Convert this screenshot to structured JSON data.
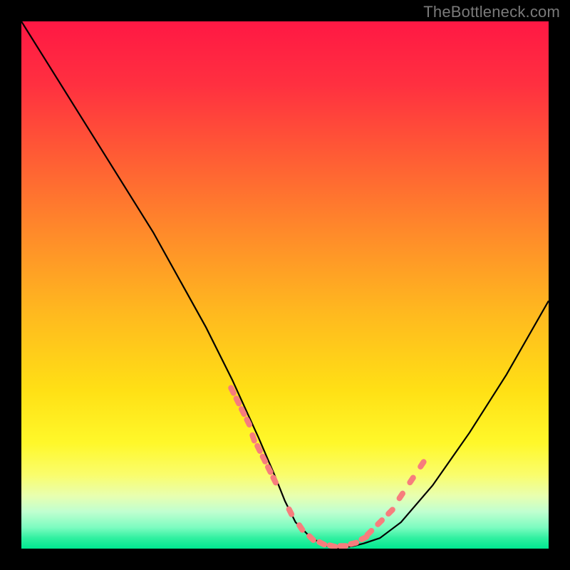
{
  "watermark": "TheBottleneck.com",
  "gradient_stops": [
    {
      "offset": "0%",
      "color": "#ff1844"
    },
    {
      "offset": "12%",
      "color": "#ff3040"
    },
    {
      "offset": "25%",
      "color": "#ff5a35"
    },
    {
      "offset": "40%",
      "color": "#ff8a2a"
    },
    {
      "offset": "55%",
      "color": "#ffb81f"
    },
    {
      "offset": "70%",
      "color": "#ffe015"
    },
    {
      "offset": "80%",
      "color": "#fff82a"
    },
    {
      "offset": "86%",
      "color": "#fafd6c"
    },
    {
      "offset": "90%",
      "color": "#e8ffb0"
    },
    {
      "offset": "93%",
      "color": "#c0ffd0"
    },
    {
      "offset": "96%",
      "color": "#7cfcc0"
    },
    {
      "offset": "98%",
      "color": "#30f0a0"
    },
    {
      "offset": "100%",
      "color": "#00e890"
    }
  ],
  "chart_data": {
    "type": "line",
    "title": "",
    "xlabel": "",
    "ylabel": "",
    "xlim": [
      0,
      100
    ],
    "ylim": [
      0,
      100
    ],
    "grid": false,
    "legend": false,
    "series": [
      {
        "name": "bottleneck_curve",
        "x": [
          0,
          5,
          10,
          15,
          20,
          25,
          30,
          35,
          40,
          45,
          48,
          50,
          52,
          55,
          58,
          60,
          63,
          65,
          68,
          72,
          78,
          85,
          92,
          100
        ],
        "values": [
          100,
          92,
          84,
          76,
          68,
          60,
          51,
          42,
          32,
          21,
          14,
          9,
          5,
          2,
          0.5,
          0,
          0.5,
          1,
          2,
          5,
          12,
          22,
          33,
          47
        ]
      },
      {
        "name": "marker_cluster",
        "x": [
          40,
          41,
          42,
          43,
          44,
          45,
          46,
          47,
          48,
          51,
          53,
          55,
          57,
          59,
          61,
          63,
          65,
          66,
          68,
          70,
          72,
          74,
          76
        ],
        "values": [
          30,
          28,
          26,
          24,
          21,
          19,
          17,
          15,
          13,
          7,
          4,
          2,
          1,
          0.5,
          0.5,
          1,
          2,
          3,
          5,
          7,
          10,
          13,
          16
        ]
      }
    ],
    "annotations": []
  }
}
